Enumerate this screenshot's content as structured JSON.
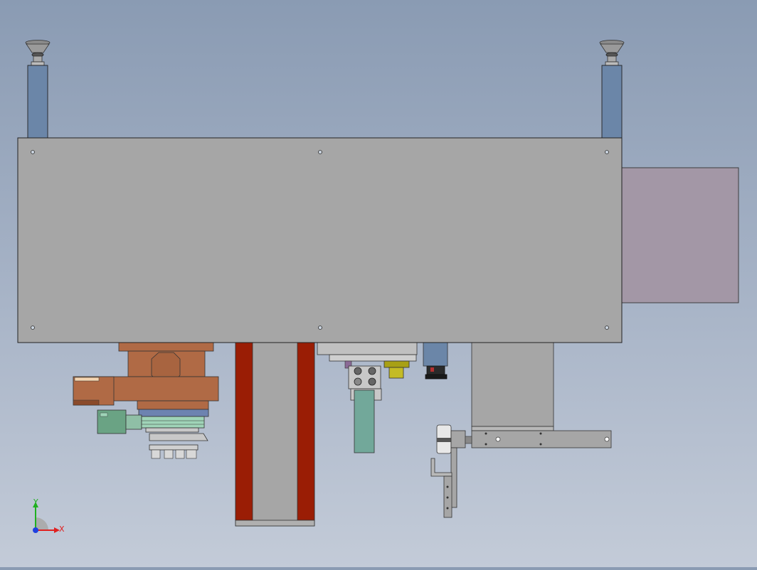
{
  "triad": {
    "x_label": "X",
    "y_label": "Y"
  },
  "colors": {
    "background_top": "#8a9bb3",
    "background_bottom": "#c3cbd8",
    "main_panel": "#a6a6a6",
    "side_box": "#a397a6",
    "red_rails": "#9a1d05",
    "copper_assembly": "#b06a45",
    "green_motor": "#6aa384",
    "blue_plate": "#6d83b0",
    "yellow_part": "#a8a015",
    "teal_slider": "#72a89a",
    "leg_columns": "#6b86a8",
    "triad_x": "#e02020",
    "triad_y": "#20b020",
    "triad_z": "#2040e0"
  }
}
